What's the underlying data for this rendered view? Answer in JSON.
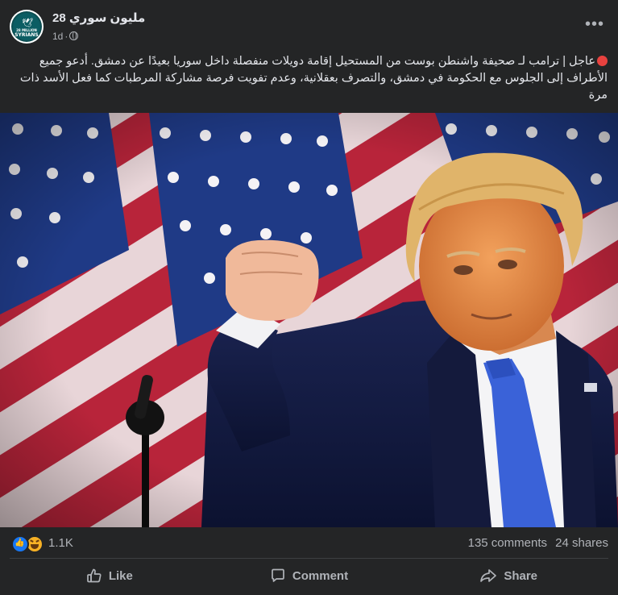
{
  "post": {
    "page_name": "مليون سوري 28",
    "time_ago": "1d",
    "avatar_text_top": "28 MILLION",
    "avatar_text_bottom": "SYRIANS",
    "body": "عاجل | ترامب لـ صحيفة  واشنطن بوست من المستحيل إقامة دويلات منفصلة داخل سوريا بعيدًا عن دمشق. أدعو جميع الأطراف إلى الجلوس مع الحكومة في دمشق، والتصرف بعقلانية، وعدم تفويت فرصة مشاركة المرطبات كما فعل الأسد ذات مرة"
  },
  "stats": {
    "reactions": "1.1K",
    "comments": "135 comments",
    "shares": "24 shares"
  },
  "actions": {
    "like": "Like",
    "comment": "Comment",
    "share": "Share"
  },
  "icons": [
    "red-circle-icon",
    "globe-icon",
    "more-icon",
    "like-reaction-icon",
    "haha-reaction-icon",
    "like-icon",
    "comment-icon",
    "share-icon"
  ],
  "colors": {
    "background": "#242526",
    "text": "#e4e6eb",
    "secondary_text": "#b0b3b8",
    "like_blue": "#1877f2",
    "red_dot": "#e8423f"
  }
}
